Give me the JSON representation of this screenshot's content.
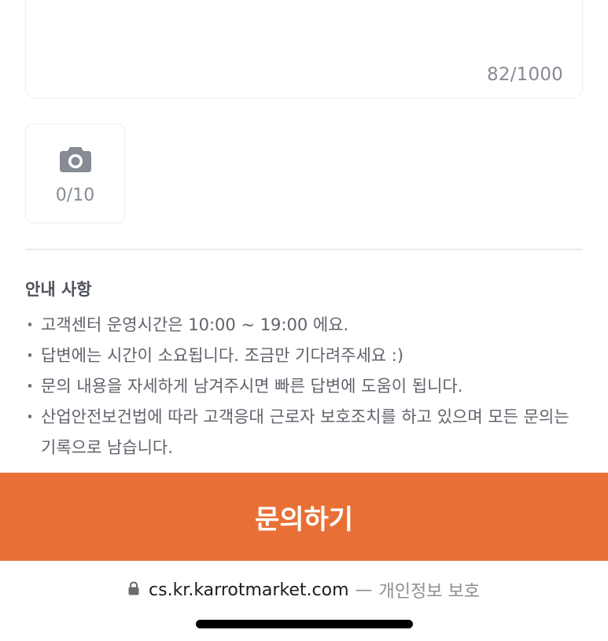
{
  "form": {
    "char_count": "82/1000",
    "photo_count": "0/10",
    "camera_icon": "camera-icon"
  },
  "notice": {
    "title": "안내 사항",
    "items": [
      "고객센터 운영시간은 10:00 ~ 19:00 에요.",
      "답변에는 시간이 소요됩니다. 조금만 기다려주세요 :)",
      "문의 내용을 자세하게 남겨주시면 빠른 답변에 도움이 됩니다.",
      "산업안전보건법에 따라 고객응대 근로자 보호조치를 하고 있으며 모든 문의는 기록으로 남습니다."
    ]
  },
  "submit": {
    "label": "문의하기",
    "color": "#e87036"
  },
  "browser": {
    "url": "cs.kr.karrotmarket.com",
    "separator": "—",
    "suffix": "개인정보 보호",
    "lock_icon": "lock-icon"
  }
}
